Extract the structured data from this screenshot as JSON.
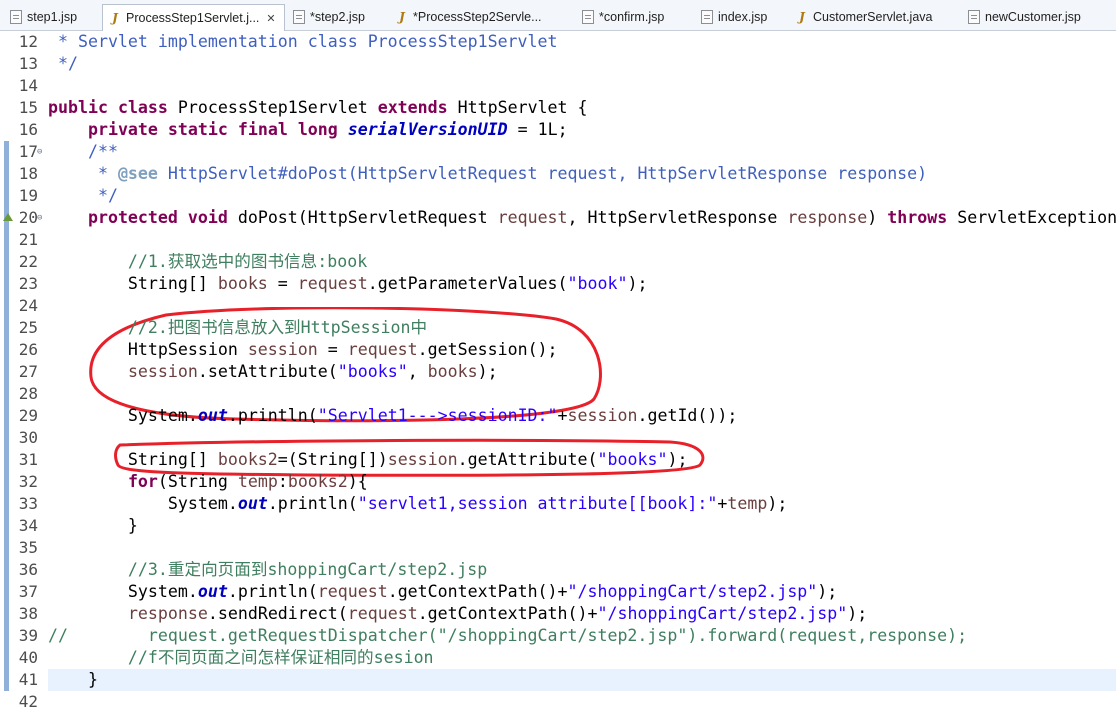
{
  "tabs": [
    {
      "label": "step1.jsp",
      "kind": "jsp"
    },
    {
      "label": "ProcessStep1Servlet.j...",
      "kind": "java",
      "active": true
    },
    {
      "label": "*step2.jsp",
      "kind": "jsp"
    },
    {
      "label": "*ProcessStep2Servle...",
      "kind": "java"
    },
    {
      "label": "*confirm.jsp",
      "kind": "jsp"
    },
    {
      "label": "index.jsp",
      "kind": "jsp"
    },
    {
      "label": "CustomerServlet.java",
      "kind": "java"
    },
    {
      "label": "newCustomer.jsp",
      "kind": "jsp"
    }
  ],
  "close_glyph": "✕",
  "colors": {
    "keyword": "#7f0055",
    "comment": "#3f7f5f",
    "javadoc": "#3f5fbf",
    "string": "#2a00ff",
    "variable": "#6a3e3e",
    "field": "#0000c0",
    "annotation_circle": "#e8202a",
    "current_line": "#e8f2fe"
  },
  "lines": [
    {
      "n": "12",
      "segs": [
        [
          " * Servlet implementation class ProcessStep1Servlet",
          "jd"
        ]
      ]
    },
    {
      "n": "13",
      "segs": [
        [
          " */",
          "jd"
        ]
      ]
    },
    {
      "n": "14",
      "segs": []
    },
    {
      "n": "15",
      "segs": [
        [
          "public",
          "kw"
        ],
        [
          " ",
          ""
        ],
        [
          "class",
          "kw"
        ],
        [
          " ProcessStep1Servlet ",
          ""
        ],
        [
          "extends",
          "kw"
        ],
        [
          " HttpServlet {",
          ""
        ]
      ]
    },
    {
      "n": "16",
      "segs": [
        [
          "    ",
          ""
        ],
        [
          "private",
          "kw"
        ],
        [
          " ",
          ""
        ],
        [
          "static",
          "kw"
        ],
        [
          " ",
          ""
        ],
        [
          "final",
          "kw"
        ],
        [
          " ",
          ""
        ],
        [
          "long",
          "kw"
        ],
        [
          " ",
          ""
        ],
        [
          "serialVersionUID",
          "fi"
        ],
        [
          " = 1L;",
          ""
        ]
      ]
    },
    {
      "n": "17",
      "fold": "⊖",
      "mark": true,
      "segs": [
        [
          "    /**",
          "jd"
        ]
      ]
    },
    {
      "n": "18",
      "mark": true,
      "segs": [
        [
          "     * ",
          "jd"
        ],
        [
          "@see",
          "jdt"
        ],
        [
          " HttpServlet#doPost(HttpServletRequest request, HttpServletResponse response)",
          "jd"
        ]
      ]
    },
    {
      "n": "19",
      "mark": true,
      "segs": [
        [
          "     */",
          "jd"
        ]
      ]
    },
    {
      "n": "20",
      "fold": "⊖",
      "mark": true,
      "override": true,
      "segs": [
        [
          "    ",
          ""
        ],
        [
          "protected",
          "kw"
        ],
        [
          " ",
          ""
        ],
        [
          "void",
          "kw"
        ],
        [
          " doPost(HttpServletRequest ",
          ""
        ],
        [
          "request",
          "vr"
        ],
        [
          ", HttpServletResponse ",
          ""
        ],
        [
          "response",
          "vr"
        ],
        [
          ") ",
          ""
        ],
        [
          "throws",
          "kw"
        ],
        [
          " ServletException",
          ""
        ]
      ]
    },
    {
      "n": "21",
      "mark": true,
      "segs": []
    },
    {
      "n": "22",
      "mark": true,
      "segs": [
        [
          "        //1.获取选中的图书信息:book",
          "cm"
        ]
      ]
    },
    {
      "n": "23",
      "mark": true,
      "segs": [
        [
          "        String[] ",
          ""
        ],
        [
          "books",
          "vr"
        ],
        [
          " = ",
          ""
        ],
        [
          "request",
          "vr"
        ],
        [
          ".getParameterValues(",
          ""
        ],
        [
          "\"book\"",
          "st"
        ],
        [
          ");",
          ""
        ]
      ]
    },
    {
      "n": "24",
      "mark": true,
      "segs": []
    },
    {
      "n": "25",
      "mark": true,
      "segs": [
        [
          "        //2.把图书信息放入到HttpSession中",
          "cm"
        ]
      ]
    },
    {
      "n": "26",
      "mark": true,
      "segs": [
        [
          "        HttpSession ",
          ""
        ],
        [
          "session",
          "vr"
        ],
        [
          " = ",
          ""
        ],
        [
          "request",
          "vr"
        ],
        [
          ".getSession();",
          ""
        ]
      ]
    },
    {
      "n": "27",
      "mark": true,
      "segs": [
        [
          "        ",
          ""
        ],
        [
          "session",
          "vr"
        ],
        [
          ".setAttribute(",
          ""
        ],
        [
          "\"books\"",
          "st"
        ],
        [
          ", ",
          ""
        ],
        [
          "books",
          "vr"
        ],
        [
          ");",
          ""
        ]
      ]
    },
    {
      "n": "28",
      "mark": true,
      "segs": []
    },
    {
      "n": "29",
      "mark": true,
      "segs": [
        [
          "        System.",
          ""
        ],
        [
          "out",
          "fi"
        ],
        [
          ".println(",
          ""
        ],
        [
          "\"Servlet1--->sessionID:\"",
          "st"
        ],
        [
          "+",
          ""
        ],
        [
          "session",
          "vr"
        ],
        [
          ".getId());",
          ""
        ]
      ]
    },
    {
      "n": "30",
      "mark": true,
      "segs": []
    },
    {
      "n": "31",
      "mark": true,
      "segs": [
        [
          "        String[] ",
          ""
        ],
        [
          "books2",
          "vr"
        ],
        [
          "=(String[])",
          ""
        ],
        [
          "session",
          "vr"
        ],
        [
          ".getAttribute(",
          ""
        ],
        [
          "\"books\"",
          "st"
        ],
        [
          ");",
          ""
        ]
      ]
    },
    {
      "n": "32",
      "mark": true,
      "segs": [
        [
          "        ",
          ""
        ],
        [
          "for",
          "kw"
        ],
        [
          "(String ",
          ""
        ],
        [
          "temp",
          "vr"
        ],
        [
          ":",
          ""
        ],
        [
          "books2",
          "vr"
        ],
        [
          "){",
          ""
        ]
      ]
    },
    {
      "n": "33",
      "mark": true,
      "segs": [
        [
          "            System.",
          ""
        ],
        [
          "out",
          "fi"
        ],
        [
          ".println(",
          ""
        ],
        [
          "\"servlet1,session attribute[[book]:\"",
          "st"
        ],
        [
          "+",
          ""
        ],
        [
          "temp",
          "vr"
        ],
        [
          ");",
          ""
        ]
      ]
    },
    {
      "n": "34",
      "mark": true,
      "segs": [
        [
          "        }",
          ""
        ]
      ]
    },
    {
      "n": "35",
      "mark": true,
      "segs": []
    },
    {
      "n": "36",
      "mark": true,
      "segs": [
        [
          "        //3.重定向页面到shoppingCart/step2.jsp",
          "cm"
        ]
      ]
    },
    {
      "n": "37",
      "mark": true,
      "segs": [
        [
          "        System.",
          ""
        ],
        [
          "out",
          "fi"
        ],
        [
          ".println(",
          ""
        ],
        [
          "request",
          "vr"
        ],
        [
          ".getContextPath()+",
          ""
        ],
        [
          "\"/shoppingCart/step2.jsp\"",
          "st"
        ],
        [
          ");",
          ""
        ]
      ]
    },
    {
      "n": "38",
      "mark": true,
      "segs": [
        [
          "        ",
          ""
        ],
        [
          "response",
          "vr"
        ],
        [
          ".sendRedirect(",
          ""
        ],
        [
          "request",
          "vr"
        ],
        [
          ".getContextPath()+",
          ""
        ],
        [
          "\"/shoppingCart/step2.jsp\"",
          "st"
        ],
        [
          ");",
          ""
        ]
      ]
    },
    {
      "n": "39",
      "mark": true,
      "segs": [
        [
          "//        request.getRequestDispatcher(\"/shoppingCart/step2.jsp\").forward(request,response);",
          "cm"
        ]
      ]
    },
    {
      "n": "40",
      "mark": true,
      "segs": [
        [
          "        //f不同页面之间怎样保证相同的sesion",
          "cm"
        ]
      ]
    },
    {
      "n": "41",
      "mark": true,
      "current": true,
      "segs": [
        [
          "    }",
          ""
        ]
      ]
    },
    {
      "n": "42",
      "segs": []
    }
  ]
}
